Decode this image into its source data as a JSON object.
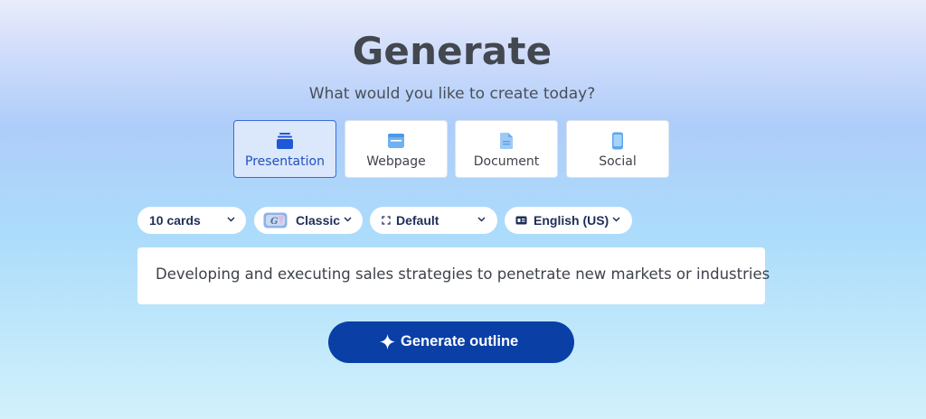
{
  "header": {
    "title": "Generate",
    "subtitle": "What would you like to create today?"
  },
  "types": [
    {
      "label": "Presentation",
      "icon": "presentation-icon",
      "selected": true
    },
    {
      "label": "Webpage",
      "icon": "webpage-icon",
      "selected": false
    },
    {
      "label": "Document",
      "icon": "document-icon",
      "selected": false
    },
    {
      "label": "Social",
      "icon": "social-icon",
      "selected": false
    }
  ],
  "options": {
    "cards": "10 cards",
    "theme": "Classic",
    "layout": "Default",
    "language": "English (US)"
  },
  "prompt": {
    "value": "Developing and executing sales strategies to penetrate new markets or industries"
  },
  "actions": {
    "generate_label": "Generate outline"
  },
  "colors": {
    "accent": "#0a3fa6",
    "selected_card_bg": "#dbe7fb",
    "selected_card_border": "#3a6ed8",
    "pill_text": "#1e2e58"
  }
}
